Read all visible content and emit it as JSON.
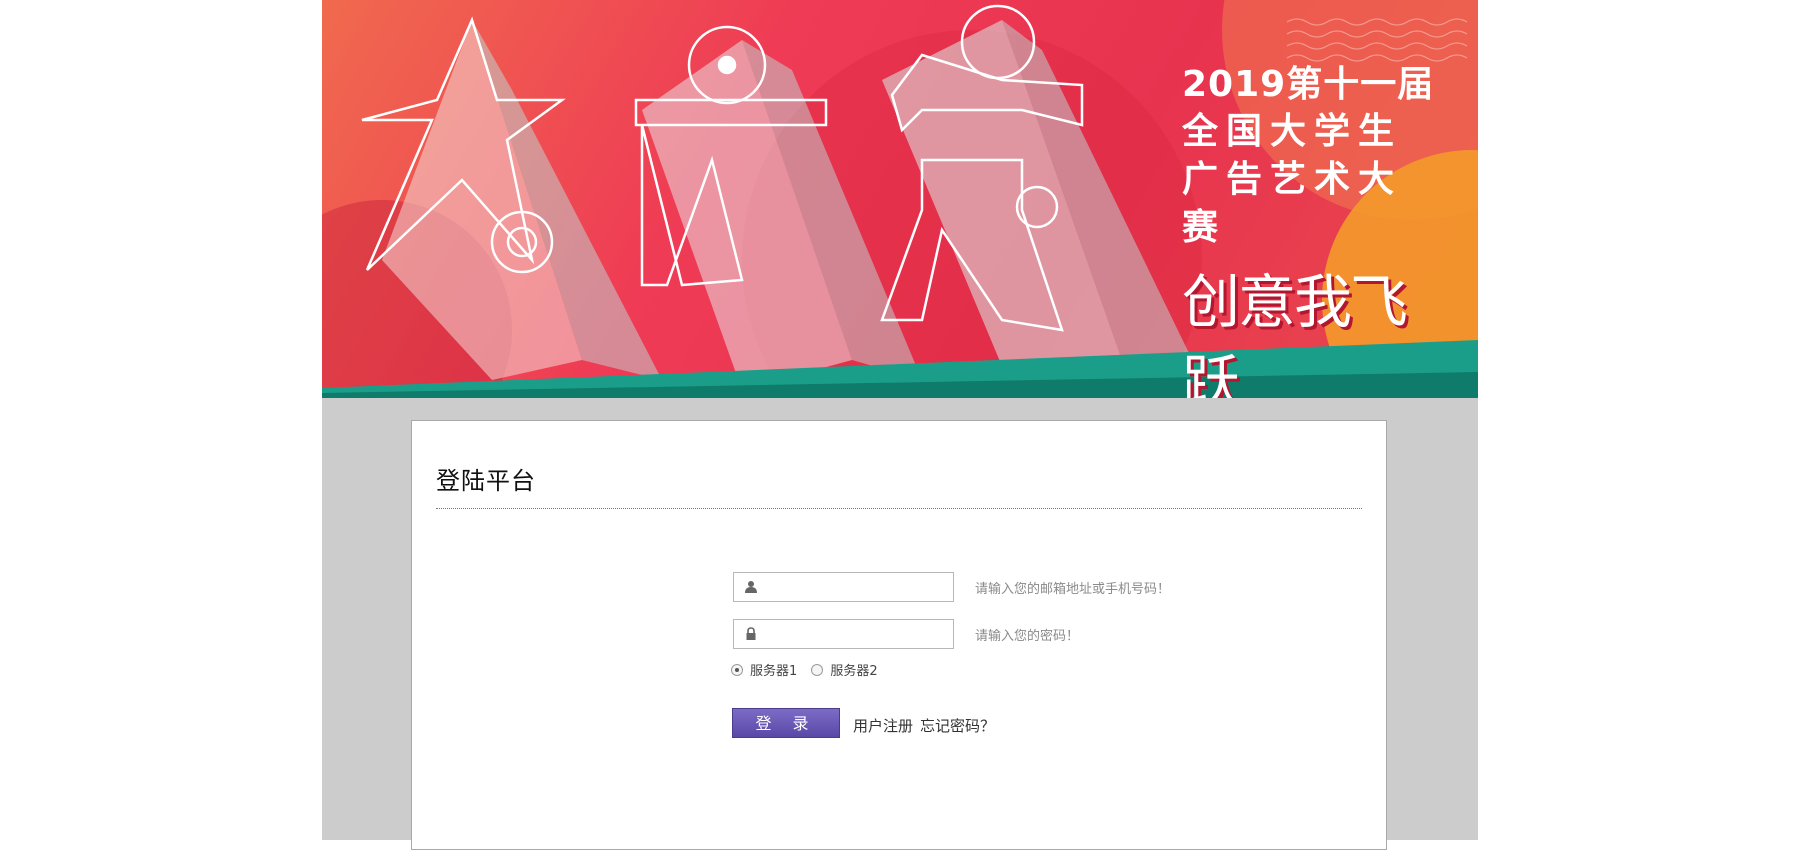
{
  "banner": {
    "title_line1": "2019第十一届",
    "title_line2": "全国大学生",
    "title_line3": "广告艺术大赛",
    "slogan": "创意我飞跃",
    "logo_chars": "大广赛"
  },
  "colors": {
    "banner_red": "#e8334f",
    "banner_orange": "#f06a4e",
    "banner_teal": "#1a9e8a",
    "page_gray": "#cccccc",
    "button_purple": "#5a48a7"
  },
  "panel": {
    "title": "登陆平台"
  },
  "form": {
    "username": {
      "value": "",
      "icon": "user-icon",
      "hint": "请输入您的邮箱地址或手机号码！"
    },
    "password": {
      "value": "",
      "icon": "lock-icon",
      "hint": "请输入您的密码！"
    },
    "servers": [
      {
        "label": "服务器1",
        "checked": true
      },
      {
        "label": "服务器2",
        "checked": false
      }
    ],
    "login_label": "登 录",
    "register_label": "用户注册",
    "forgot_label": "忘记密码？"
  }
}
